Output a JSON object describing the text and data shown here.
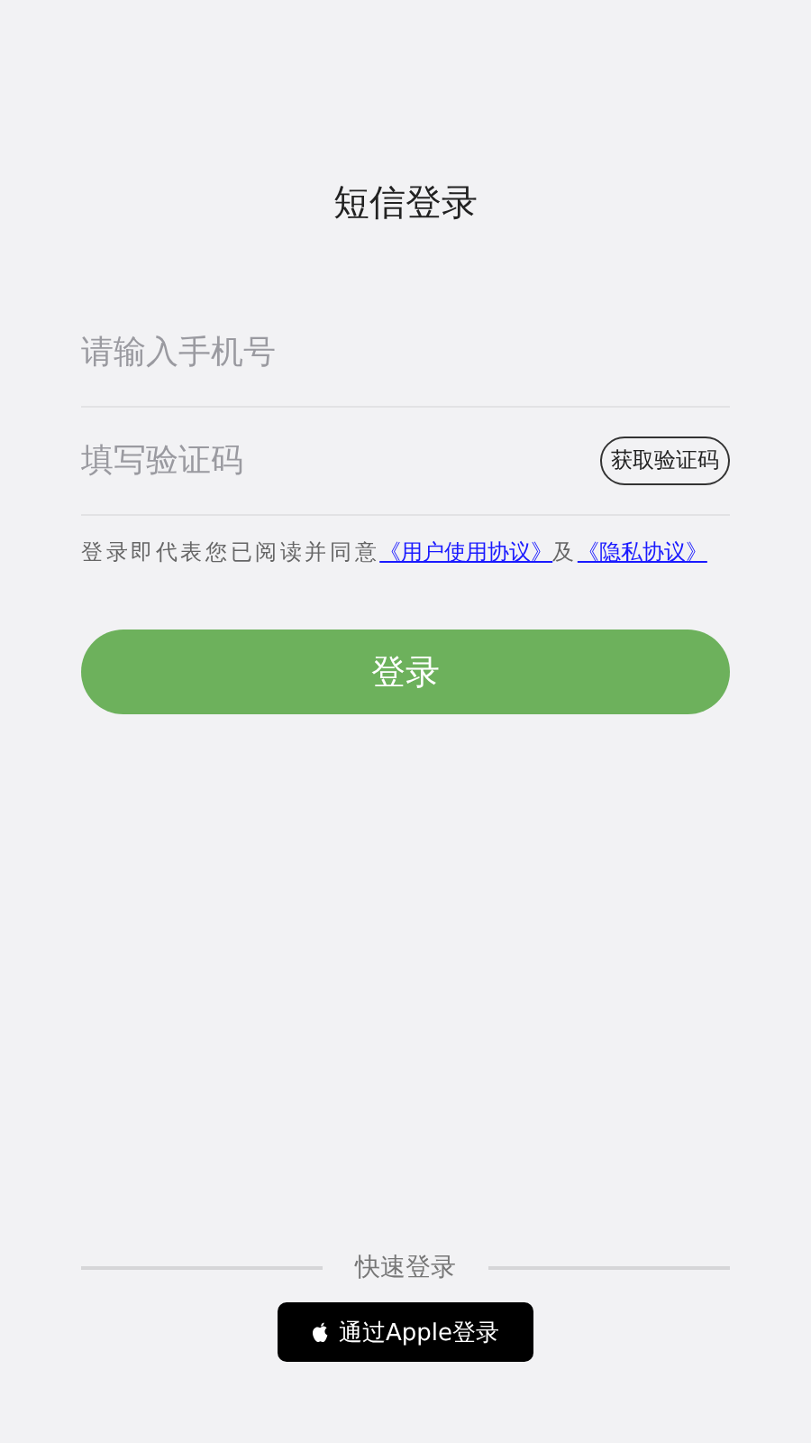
{
  "title": "短信登录",
  "phone_field": {
    "placeholder": "请输入手机号"
  },
  "code_field": {
    "placeholder": "填写验证码"
  },
  "get_code_button": "获取验证码",
  "agreement": {
    "text": "登录即代表您已阅读并同意",
    "link_1": "《用户使用协议》",
    "joiner": "及",
    "link_2": "《隐私协议》"
  },
  "login_button": "登录",
  "quick_login": {
    "label": "快速登录",
    "apple_button": "通过Apple登录"
  }
}
